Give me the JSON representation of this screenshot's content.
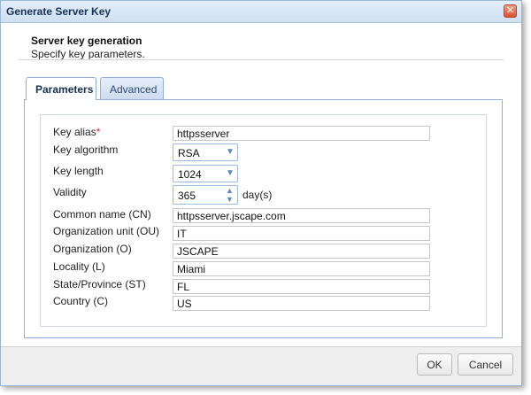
{
  "window": {
    "title": "Generate Server Key"
  },
  "header": {
    "title": "Server key generation",
    "subtitle": "Specify key parameters."
  },
  "tabs": [
    {
      "label": "Parameters",
      "active": true
    },
    {
      "label": "Advanced",
      "active": false
    }
  ],
  "form": {
    "key_alias": {
      "label": "Key alias",
      "required_mark": "*",
      "value": "httpsserver"
    },
    "key_algorithm": {
      "label": "Key algorithm",
      "value": "RSA"
    },
    "key_length": {
      "label": "Key length",
      "value": "1024"
    },
    "validity": {
      "label": "Validity",
      "value": "365",
      "unit": "day(s)"
    },
    "common_name": {
      "label": "Common name (CN)",
      "value": "httpsserver.jscape.com"
    },
    "org_unit": {
      "label": "Organization unit (OU)",
      "value": "IT"
    },
    "organization": {
      "label": "Organization (O)",
      "value": "JSCAPE"
    },
    "locality": {
      "label": "Locality (L)",
      "value": "Miami"
    },
    "state": {
      "label": "State/Province (ST)",
      "value": "FL"
    },
    "country": {
      "label": "Country (C)",
      "value": "US"
    }
  },
  "buttons": {
    "ok": "OK",
    "cancel": "Cancel"
  },
  "icons": {
    "close": "close-icon",
    "chevron": "chevron-down-icon"
  },
  "colors": {
    "titlebar": "#cfdff2",
    "accent": "#5b87c5",
    "close": "#d9502e"
  }
}
